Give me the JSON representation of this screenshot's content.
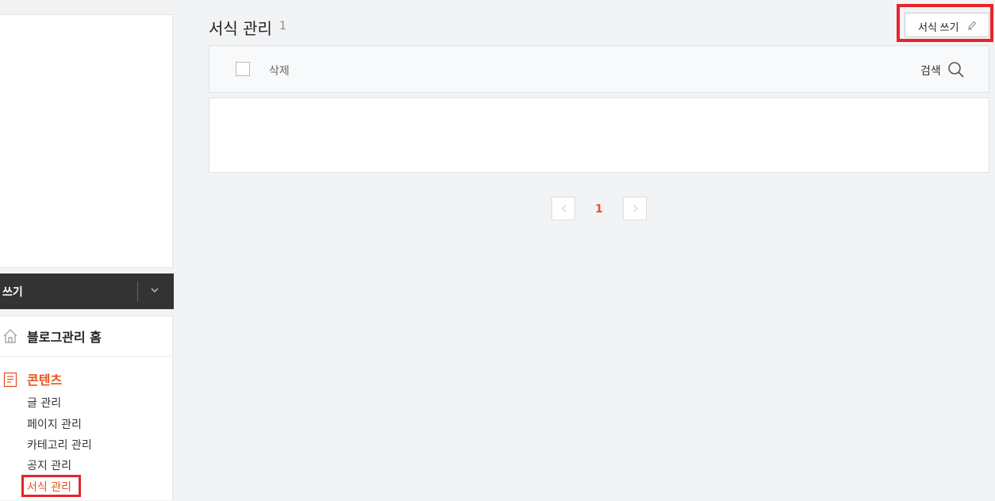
{
  "sidebar": {
    "write_label": "쓰기",
    "nav_home": "블로그관리 홈",
    "section_contents": "콘텐츠",
    "content_items": [
      "글 관리",
      "페이지 관리",
      "카테고리 관리",
      "공지 관리",
      "서식 관리"
    ],
    "active_item_index": 4
  },
  "main": {
    "title": "서식 관리",
    "count": "1",
    "write_button": "서식 쓰기",
    "toolbar": {
      "delete_label": "삭제",
      "search_label": "검색"
    },
    "pagination": {
      "current_page": "1"
    }
  },
  "colors": {
    "accent": "#eb531f",
    "highlight_box": "#e5252a",
    "dark_bar": "#333333"
  },
  "icons": {
    "home": "home-icon",
    "contents": "document-icon",
    "pen": "pen-icon",
    "search": "search-icon",
    "chevron_down": "chevron-down-icon",
    "prev": "chevron-left-icon",
    "next": "chevron-right-icon"
  }
}
